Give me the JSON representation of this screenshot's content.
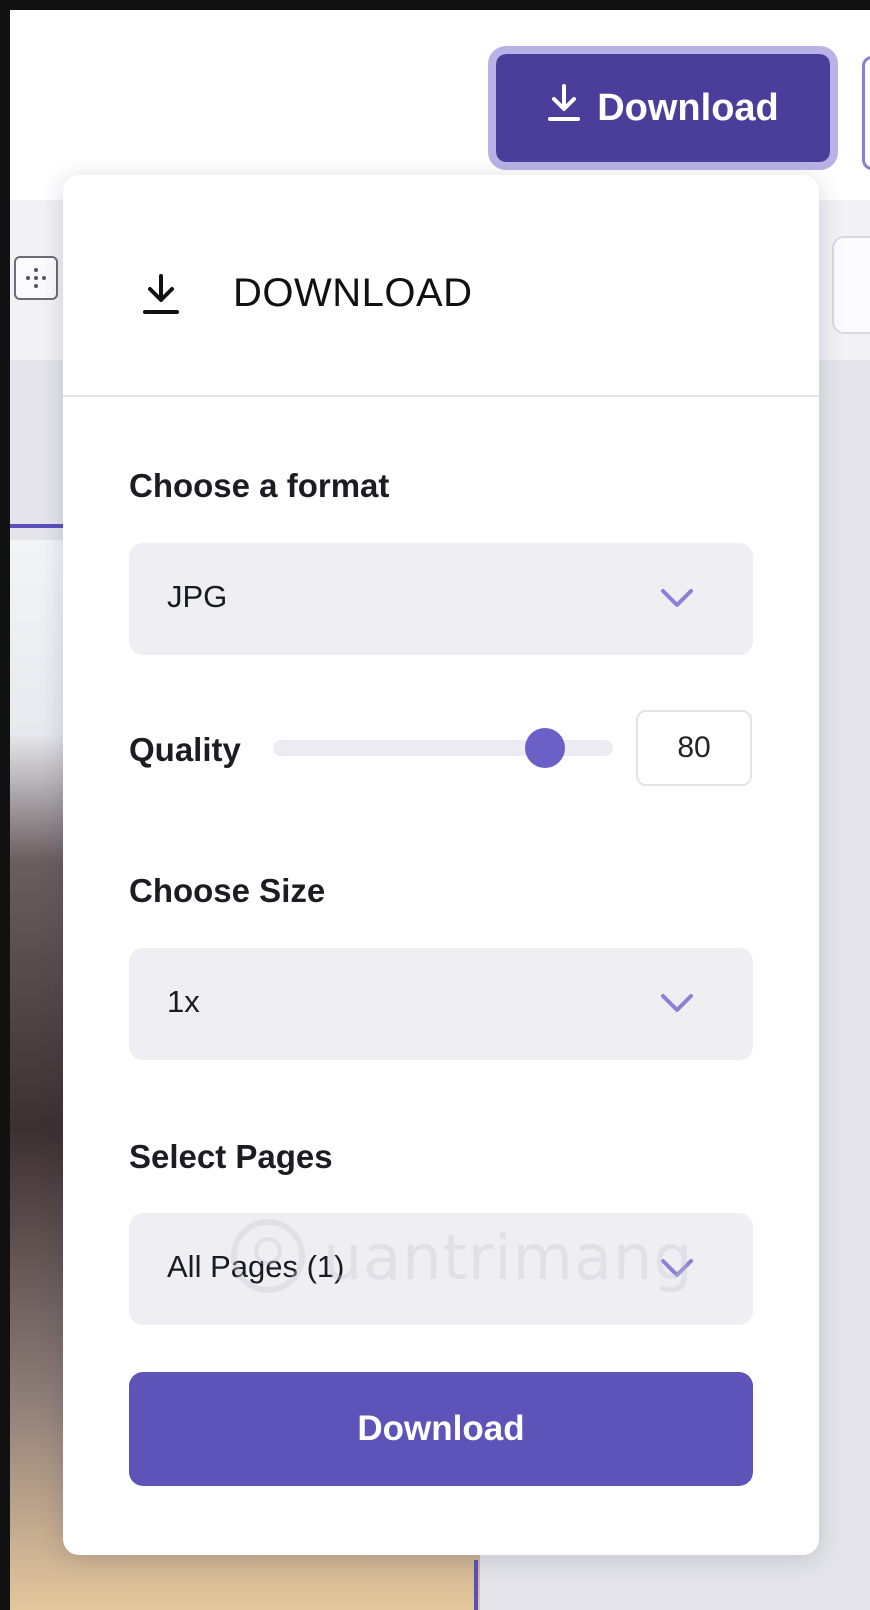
{
  "header": {
    "download_button_label": "Download"
  },
  "popover": {
    "title": "DOWNLOAD",
    "format": {
      "label": "Choose a format",
      "selected": "JPG"
    },
    "quality": {
      "label": "Quality",
      "value": "80",
      "level_percent": 80
    },
    "size": {
      "label": "Choose Size",
      "selected": "1x"
    },
    "pages": {
      "label": "Select Pages",
      "selected": "All Pages (1)"
    },
    "download_button_label": "Download"
  },
  "watermark": {
    "text": "uantrimang"
  },
  "colors": {
    "accent": "#5d53b9",
    "header_button": "#4b3e9b",
    "slider_thumb": "#6a60c8",
    "chevron": "#8a80d6"
  },
  "icons": {
    "download": "download-icon",
    "chevron": "chevron-down-icon",
    "grid": "grid-icon"
  }
}
